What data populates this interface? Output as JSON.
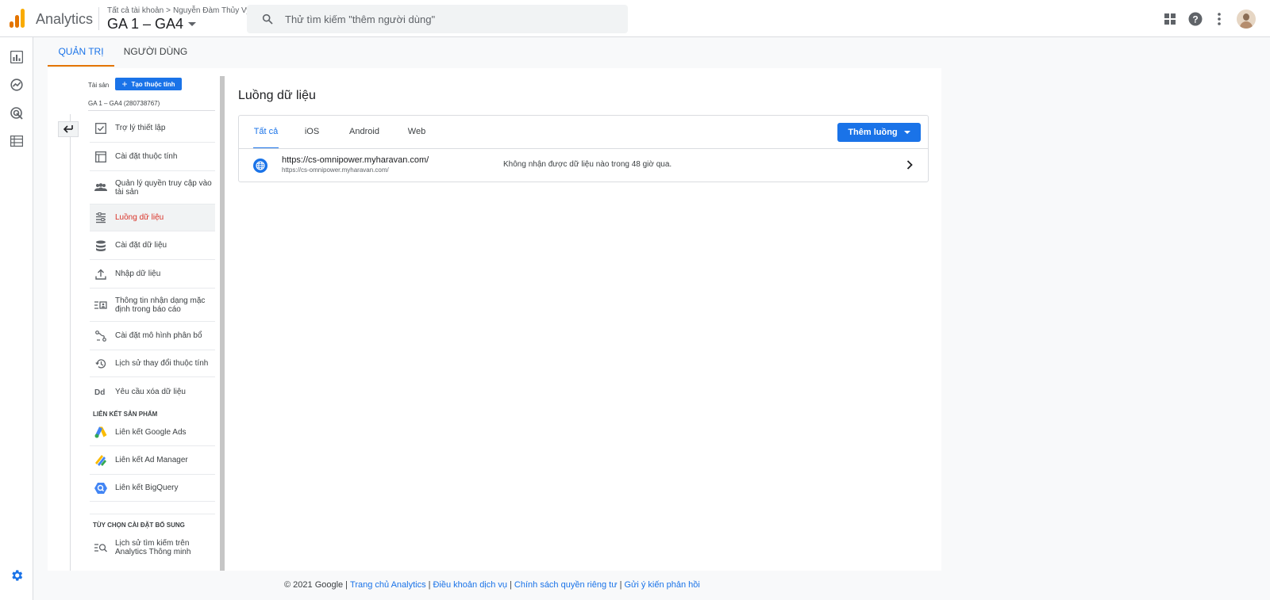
{
  "app": {
    "name": "Analytics",
    "breadcrumb": [
      "Tất cả tài khoản",
      ">",
      "Nguyễn Đàm Thủy Vy"
    ],
    "property": "GA 1 – GA4"
  },
  "search": {
    "placeholder": "Thử tìm kiếm \"thêm người dùng\""
  },
  "admin_tabs": [
    {
      "label": "QUẢN TRỊ",
      "active": true
    },
    {
      "label": "NGƯỜI DÙNG",
      "active": false
    }
  ],
  "property_column": {
    "label": "Tài sản",
    "create_button": "Tạo thuộc tính",
    "property_name": "GA 1 – GA4 (280738767)",
    "items": [
      {
        "label": "Trợ lý thiết lập",
        "icon": "checklist-icon"
      },
      {
        "label": "Cài đặt thuộc tính",
        "icon": "property-layout-icon"
      },
      {
        "label": "Quản lý quyền truy cập vào tài sản",
        "icon": "people-icon"
      },
      {
        "label": "Luồng dữ liệu",
        "icon": "data-streams-icon",
        "selected": true
      },
      {
        "label": "Cài đặt dữ liệu",
        "icon": "database-icon"
      },
      {
        "label": "Nhập dữ liệu",
        "icon": "upload-icon"
      },
      {
        "label": "Thông tin nhận dạng mặc định trong báo cáo",
        "icon": "reporting-identity-icon"
      },
      {
        "label": "Cài đặt mô hình phân bổ",
        "icon": "attribution-icon"
      },
      {
        "label": "Lịch sử thay đổi thuộc tính",
        "icon": "history-icon"
      },
      {
        "label": "Yêu cầu xóa dữ liệu",
        "icon": "data-deletion-icon"
      }
    ],
    "product_links_title": "LIÊN KẾT SẢN PHẨM",
    "product_links": [
      {
        "label": "Liên kết Google Ads",
        "icon": "google-ads-icon"
      },
      {
        "label": "Liên kết Ad Manager",
        "icon": "ad-manager-icon"
      },
      {
        "label": "Liên kết BigQuery",
        "icon": "bigquery-icon"
      }
    ],
    "additional_title": "TÙY CHỌN CÀI ĐẶT BỔ SUNG",
    "additional": [
      {
        "label": "Lịch sử tìm kiếm trên Analytics Thông minh",
        "icon": "search-history-icon"
      }
    ]
  },
  "main": {
    "title": "Luồng dữ liệu",
    "tabs": [
      {
        "label": "Tất cả",
        "active": true
      },
      {
        "label": "iOS",
        "active": false
      },
      {
        "label": "Android",
        "active": false
      },
      {
        "label": "Web",
        "active": false
      }
    ],
    "add_button": "Thêm luồng",
    "streams": [
      {
        "name": "https://cs-omnipower.myharavan.com/",
        "url": "https://cs-omnipower.myharavan.com/",
        "status": "Không nhận được dữ liệu nào trong 48 giờ qua."
      }
    ]
  },
  "footer": {
    "copyright": "© 2021 Google",
    "links": [
      "Trang chủ Analytics",
      "Điều khoản dịch vụ",
      "Chính sách quyền riêng tư",
      "Gửi ý kiến phản hồi"
    ]
  },
  "colors": {
    "primary": "#1a73e8",
    "accent": "#e37400",
    "selected_text": "#d93025"
  }
}
